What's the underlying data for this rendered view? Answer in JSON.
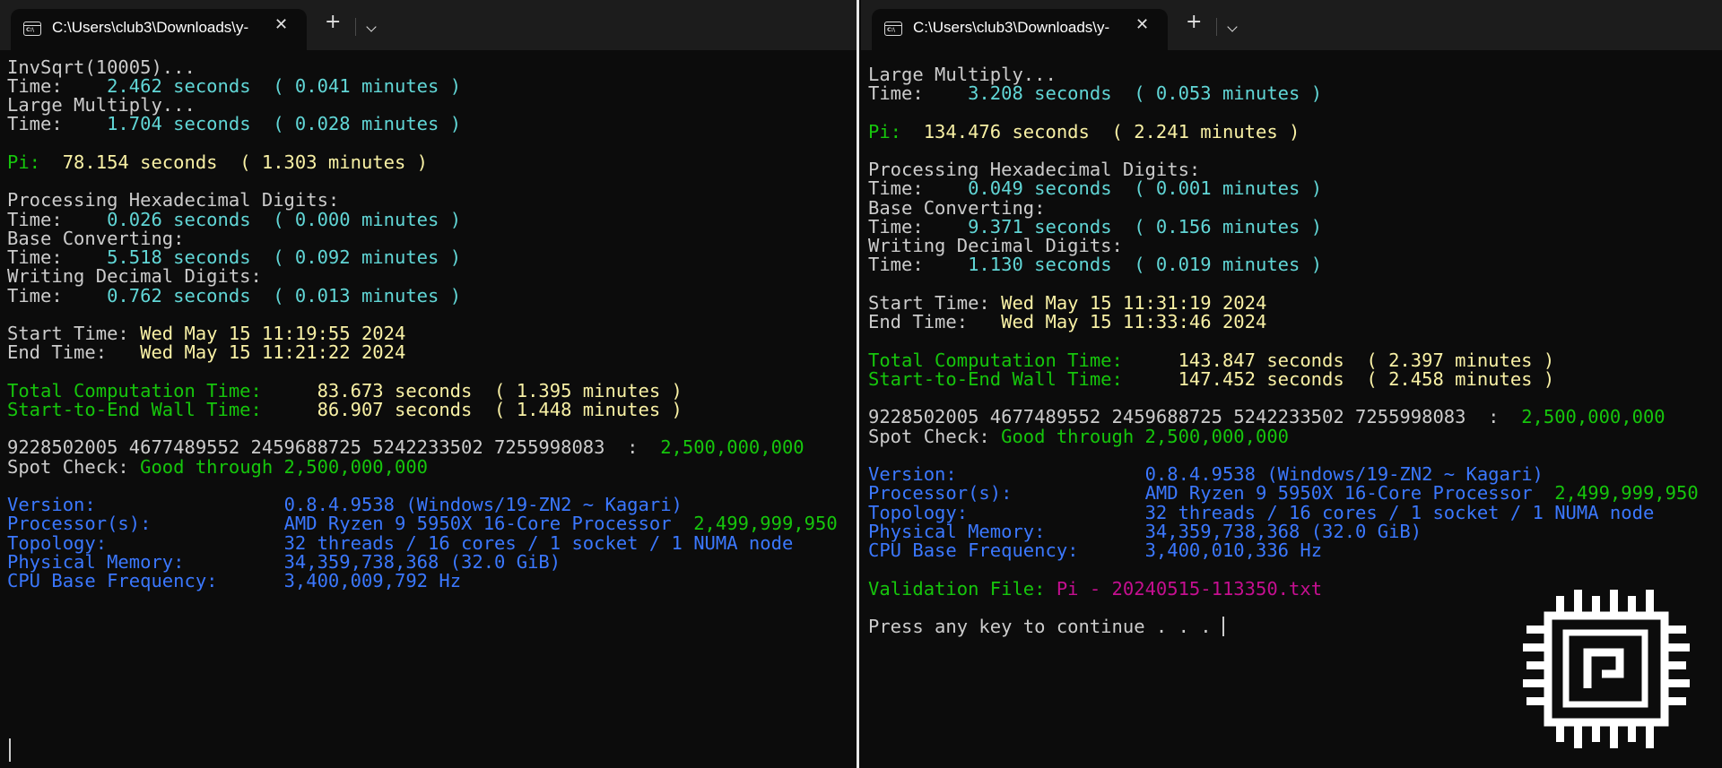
{
  "left": {
    "tab_title": "C:\\Users\\club3\\Downloads\\y-",
    "lines": {
      "invsqrt_label": "InvSqrt(10005)...",
      "invsqrt_time": "2.462 seconds  ( 0.041 minutes )",
      "mult_label": "Large Multiply...",
      "mult_time": "1.704 seconds  ( 0.028 minutes )",
      "pi_value": "78.154 seconds  ( 1.303 minutes )",
      "hex_label": "Processing Hexadecimal Digits:",
      "hex_time": "0.026 seconds  ( 0.000 minutes )",
      "base_label": "Base Converting:",
      "base_time": "5.518 seconds  ( 0.092 minutes )",
      "dec_label": "Writing Decimal Digits:",
      "dec_time": "0.762 seconds  ( 0.013 minutes )",
      "start_time": "Wed May 15 11:19:55 2024",
      "end_time": "Wed May 15 11:21:22 2024",
      "total_time": "83.673 seconds  ( 1.395 minutes )",
      "wall_time": "86.907 seconds  ( 1.448 minutes )",
      "digits": "9228502005 4677489552 2459688725 5242233502 7255998083  :  ",
      "digits_count": "2,500,000,000",
      "spot_check_value": "Good through 2,500,000,000",
      "version": "0.8.4.9538 (Windows/19-ZN2 ~ Kagari)",
      "processor": "AMD Ryzen 9 5950X 16-Core Processor  ",
      "processor_freq": "2,499,999,950",
      "topology": "32 threads / 16 cores / 1 socket / 1 NUMA node",
      "memory": "34,359,738,368 (32.0 GiB)",
      "cpu_freq": "3,400,009,792 Hz"
    }
  },
  "right": {
    "tab_title": "C:\\Users\\club3\\Downloads\\y-",
    "lines": {
      "mult_label": "Large Multiply...",
      "mult_time": "3.208 seconds  ( 0.053 minutes )",
      "pi_value": "134.476 seconds  ( 2.241 minutes )",
      "hex_label": "Processing Hexadecimal Digits:",
      "hex_time": "0.049 seconds  ( 0.001 minutes )",
      "base_label": "Base Converting:",
      "base_time": "9.371 seconds  ( 0.156 minutes )",
      "dec_label": "Writing Decimal Digits:",
      "dec_time": "1.130 seconds  ( 0.019 minutes )",
      "start_time": "Wed May 15 11:31:19 2024",
      "end_time": "Wed May 15 11:33:46 2024",
      "total_time": "143.847 seconds  ( 2.397 minutes )",
      "wall_time": "147.452 seconds  ( 2.458 minutes )",
      "digits": "9228502005 4677489552 2459688725 5242233502 7255998083  :  ",
      "digits_count": "2,500,000,000",
      "spot_check_value": "Good through 2,500,000,000",
      "version": "0.8.4.9538 (Windows/19-ZN2 ~ Kagari)",
      "processor": "AMD Ryzen 9 5950X 16-Core Processor  ",
      "processor_freq": "2,499,999,950",
      "topology": "32 threads / 16 cores / 1 socket / 1 NUMA node",
      "memory": "34,359,738,368 (32.0 GiB)",
      "cpu_freq": "3,400,010,336 Hz",
      "validation_file": "Pi - 20240515-113350.txt",
      "press_key": "Press any key to continue . . . "
    }
  },
  "labels": {
    "time": "Time:    ",
    "pi": "Pi:  ",
    "pi_wide": "Pi:  ",
    "start": "Start Time: ",
    "end": "End Time:   ",
    "total": "Total Computation Time:     ",
    "wall": "Start-to-End Wall Time:     ",
    "spot": "Spot Check: ",
    "version": "Version:                 ",
    "processor": "Processor(s):            ",
    "topology": "Topology:                ",
    "memory": "Physical Memory:         ",
    "freq": "CPU Base Frequency:      ",
    "validation": "Validation File: "
  },
  "icons": {
    "tab_icon_text": "C:\\",
    "close": "✕",
    "new_tab": "+"
  },
  "colors": {
    "background": "#0c0c0c",
    "default_text": "#cccccc",
    "cyan": "#61d6d6",
    "yellow": "#f9f1a5",
    "green": "#16c60c",
    "blue": "#3b78ff",
    "magenta": "#c50f90"
  }
}
